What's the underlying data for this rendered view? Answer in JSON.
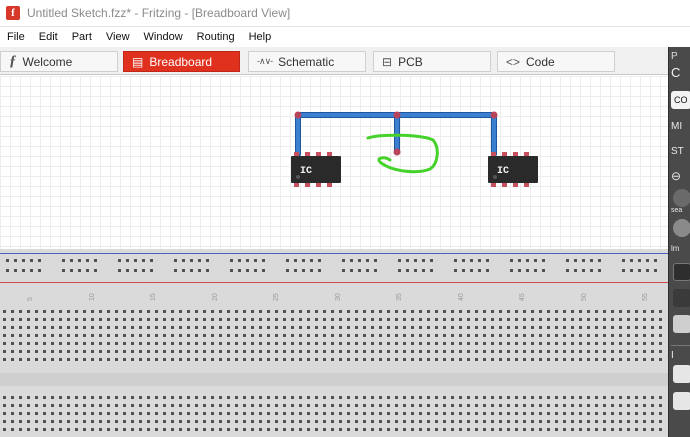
{
  "window": {
    "title": "Untitled Sketch.fzz* - Fritzing - [Breadboard View]",
    "app_icon": "fritzing-logo-icon",
    "app_icon_glyph": "f"
  },
  "menu": {
    "items": [
      "File",
      "Edit",
      "Part",
      "View",
      "Window",
      "Routing",
      "Help"
    ]
  },
  "tabs": [
    {
      "label": "Welcome",
      "icon": "fritzing-f-icon",
      "glyph": "ƒ",
      "active": false
    },
    {
      "label": "Breadboard",
      "icon": "breadboard-icon",
      "glyph": "▤",
      "active": true
    },
    {
      "label": "Schematic",
      "icon": "resistor-icon",
      "glyph": "-∧∨-",
      "active": false
    },
    {
      "label": "PCB",
      "icon": "pcb-icon",
      "glyph": "⊟",
      "active": false
    },
    {
      "label": "Code",
      "icon": "code-brackets-icon",
      "glyph": "<>",
      "active": false
    }
  ],
  "right_panel": {
    "visible_fragments": [
      "P",
      "C",
      "CO",
      "MI",
      "ST",
      "⊖",
      "sea",
      "lm",
      "I"
    ]
  },
  "parts": {
    "ic_left": {
      "label": "IC"
    },
    "ic_right": {
      "label": "IC"
    }
  },
  "breadboard": {
    "column_numbers": [
      "5",
      "10",
      "15",
      "20",
      "25",
      "30",
      "35",
      "40",
      "45",
      "50",
      "55"
    ]
  },
  "colors": {
    "tab_active": "#e0311f",
    "wire": "#3b7fd1",
    "wire_outline": "#1f56a0",
    "wire_endpoint": "#b9435a",
    "ic_body": "#2a2a2a",
    "ic_pin": "#c8505e",
    "annotation": "#45d22a",
    "rail_blue": "#4a5fc4",
    "rail_red": "#cf4a48"
  }
}
